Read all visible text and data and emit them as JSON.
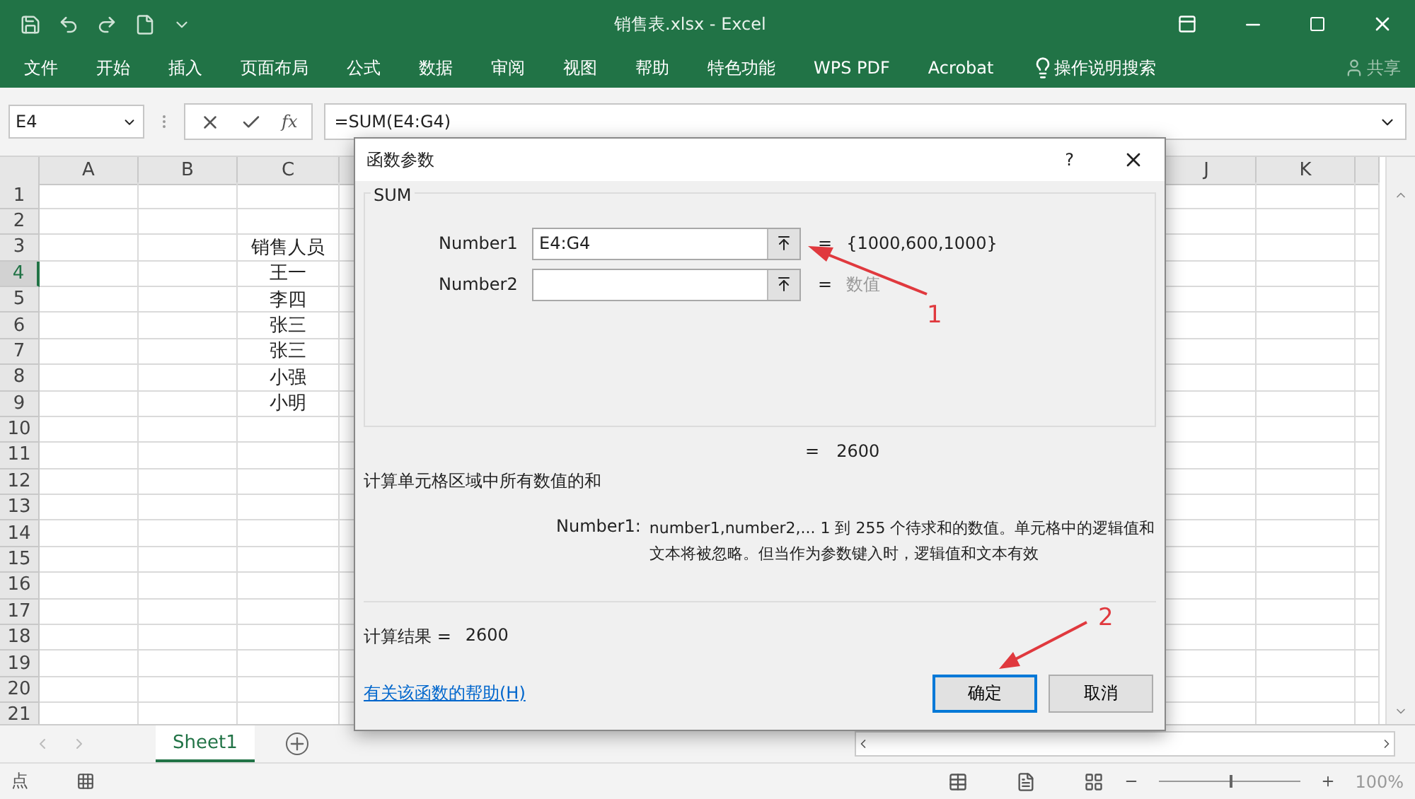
{
  "window": {
    "title": "销售表.xlsx  -  Excel"
  },
  "ribbon_tabs": [
    {
      "label": "文件"
    },
    {
      "label": "开始"
    },
    {
      "label": "插入"
    },
    {
      "label": "页面布局"
    },
    {
      "label": "公式"
    },
    {
      "label": "数据"
    },
    {
      "label": "审阅"
    },
    {
      "label": "视图"
    },
    {
      "label": "帮助"
    },
    {
      "label": "特色功能"
    },
    {
      "label": "WPS PDF"
    },
    {
      "label": "Acrobat"
    }
  ],
  "tell_me": {
    "label": "操作说明搜索"
  },
  "share": {
    "label": "共享"
  },
  "formula_bar": {
    "name_box": "E4",
    "fx": "fx",
    "formula": "=SUM(E4:G4)"
  },
  "sheet": {
    "columns_left": [
      {
        "label": "A"
      },
      {
        "label": "B"
      },
      {
        "label": "C"
      }
    ],
    "columns_right": [
      {
        "label": "J"
      },
      {
        "label": "K"
      }
    ],
    "rows": [
      {
        "label": "1",
        "selected": false
      },
      {
        "label": "2",
        "selected": false
      },
      {
        "label": "3",
        "selected": false,
        "col_c": "销售人员"
      },
      {
        "label": "4",
        "selected": true,
        "col_c": "王一"
      },
      {
        "label": "5",
        "selected": false,
        "col_c": "李四"
      },
      {
        "label": "6",
        "selected": false,
        "col_c": "张三"
      },
      {
        "label": "7",
        "selected": false,
        "col_c": "张三"
      },
      {
        "label": "8",
        "selected": false,
        "col_c": "小强"
      },
      {
        "label": "9",
        "selected": false,
        "col_c": "小明"
      },
      {
        "label": "10",
        "selected": false
      },
      {
        "label": "11",
        "selected": false
      },
      {
        "label": "12",
        "selected": false
      },
      {
        "label": "13",
        "selected": false
      },
      {
        "label": "14",
        "selected": false
      },
      {
        "label": "15",
        "selected": false
      },
      {
        "label": "16",
        "selected": false
      },
      {
        "label": "17",
        "selected": false
      },
      {
        "label": "18",
        "selected": false
      },
      {
        "label": "19",
        "selected": false
      },
      {
        "label": "20",
        "selected": false
      },
      {
        "label": "21",
        "selected": false
      }
    ]
  },
  "dialog": {
    "title": "函数参数",
    "help": "?",
    "function": "SUM",
    "arguments": [
      {
        "label": "Number1",
        "value": "E4:G4",
        "result": "{1000,600,1000}",
        "result_hint": false
      },
      {
        "label": "Number2",
        "result": "数值",
        "result_hint": true
      }
    ],
    "formula_result": "2600",
    "equals": "=",
    "description": "计算单元格区域中所有数值的和",
    "arg_help": {
      "label": "Number1:",
      "text": "number1,number2,...  1 到 255 个待求和的数值。单元格中的逻辑值和文本将被忽略。但当作为参数键入时，逻辑值和文本有效"
    },
    "result_label": "计算结果 =",
    "result_value": "2600",
    "help_link": "有关该函数的帮助(H)",
    "buttons": [
      {
        "label": "确定",
        "default": true
      },
      {
        "label": "取消",
        "default": false
      }
    ]
  },
  "sheet_tabs": [
    {
      "label": "Sheet1",
      "selected": true
    }
  ],
  "status_bar": {
    "mode": "点",
    "zoom": {
      "level": 0.5,
      "reading": "100%"
    }
  },
  "annotations": [
    {
      "label": "1"
    },
    {
      "label": "2"
    }
  ]
}
